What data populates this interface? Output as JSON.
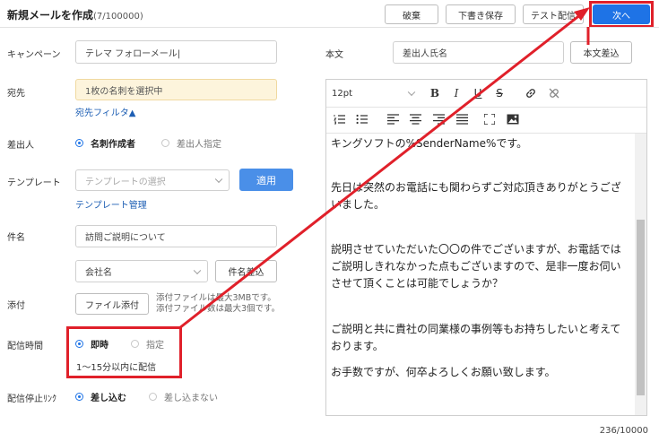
{
  "header": {
    "title": "新規メールを作成",
    "count": "(7/100000)",
    "buttons": {
      "discard": "破棄",
      "save_draft": "下書き保存",
      "test_send": "テスト配信",
      "next": "次へ"
    }
  },
  "form": {
    "campaign": {
      "label": "キャンペーン",
      "value": "テレマ フォローメール|"
    },
    "recipient": {
      "label": "宛先",
      "value": "1枚の名刺を選択中",
      "filter_link": "宛先フィルタ▲"
    },
    "sender": {
      "label": "差出人",
      "option_creator": "名刺作成者",
      "option_specify": "差出人指定"
    },
    "template": {
      "label": "テンプレート",
      "placeholder": "テンプレートの選択",
      "apply": "適用",
      "manage_link": "テンプレート管理"
    },
    "subject": {
      "label": "件名",
      "value": "訪問ご説明について",
      "insert_select": "会社名",
      "insert_button": "件名差込"
    },
    "attachment": {
      "label": "添付",
      "button": "ファイル添付",
      "note_line1": "添付ファイルは最大3MBです。",
      "note_line2": "添付ファイル数は最大3個です。"
    },
    "schedule": {
      "label": "配信時間",
      "option_now": "即時",
      "option_specify": "指定",
      "note": "1〜15分以内に配信"
    },
    "optout": {
      "label": "配信停止ﾘﾝｸ",
      "option_insert": "差し込む",
      "option_no_insert": "差し込まない"
    }
  },
  "body_panel": {
    "label": "本文",
    "insert_select": "差出人氏名",
    "insert_button": "本文差込",
    "font_size": "12pt",
    "lines": [
      "キングソフトの%SenderName%です。",
      "",
      "先日は突然のお電話にも関わらずご対応頂きありがとうござ",
      "いました。",
      "",
      "説明させていただいた〇〇の件でございますが、お電話では",
      "ご説明しきれなかった点もございますので、是非一度お伺い",
      "させて頂くことは可能でしょうか？",
      "",
      "ご説明と共に貴社の同業様の事例等もお持ちしたいと考えて",
      "おります。",
      "",
      "お手数ですが、何卒よろしくお願い致します。"
    ],
    "char_count": "236/10000"
  },
  "icons": {
    "toolbar_row1": [
      "bold-icon",
      "italic-icon",
      "underline-icon",
      "strikethrough-icon",
      "link-icon",
      "unlink-icon"
    ],
    "toolbar_row2": [
      "ordered-list-icon",
      "bullet-list-icon",
      "align-left-icon",
      "align-center-icon",
      "align-right-icon",
      "align-justify-icon",
      "fullscreen-icon",
      "image-icon"
    ]
  },
  "annotation_color": "#e0202a",
  "accent_color": "#1e73e6"
}
